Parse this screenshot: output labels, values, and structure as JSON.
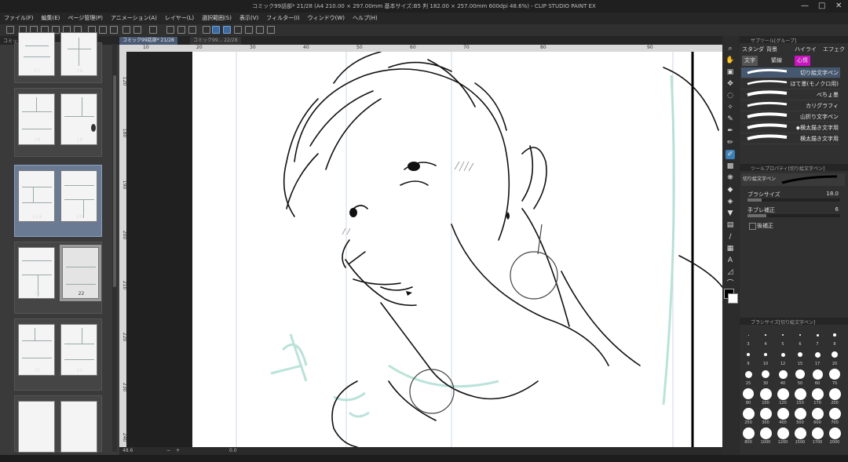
{
  "window": {
    "title": "コミック99話部* 21/28 (A4 210.00 × 297.00mm 基本サイズ:B5 判 182.00 × 257.00mm 600dpi 48.6%) - CLIP STUDIO PAINT EX",
    "controls": [
      "—",
      "□",
      "✕"
    ]
  },
  "menu": [
    "ファイル(F)",
    "編集(E)",
    "ページ管理(P)",
    "アニメーション(A)",
    "レイヤー(L)",
    "選択範囲(S)",
    "表示(V)",
    "フィルター(I)",
    "ウィンドウ(W)",
    "ヘルプ(H)"
  ],
  "page_manager": {
    "tab": "コミック99話部",
    "spreads": [
      {
        "left": "17",
        "right": "16",
        "selected": false
      },
      {
        "left": "19",
        "right": "18",
        "selected": false
      },
      {
        "left": "21★",
        "right": "20",
        "selected": true
      },
      {
        "left": "23",
        "right": "22",
        "selected": false
      },
      {
        "left": "25",
        "right": "24",
        "selected": false
      },
      {
        "left": "",
        "right": "",
        "selected": false
      }
    ]
  },
  "doc_tabs": [
    {
      "label": "コミック99話部* 21/28",
      "active": true
    },
    {
      "label": "コミック99... 22/28",
      "active": false
    }
  ],
  "ruler": {
    "h_ticks": [
      "10",
      "20",
      "30",
      "40",
      "50",
      "60",
      "70",
      "80",
      "90"
    ],
    "v_ticks": [
      "120",
      "180",
      "190",
      "200",
      "210",
      "220",
      "230",
      "240"
    ]
  },
  "status": {
    "zoom": "48.6",
    "angle": "0.0"
  },
  "subtool": {
    "header": "サブツール[グループ]",
    "groups_row1": [
      "スタンダ",
      "背景",
      "ハイライ",
      "エフェク"
    ],
    "groups_row2": [
      "文字",
      "緊線",
      "心情"
    ],
    "brushes": [
      {
        "label": "切り絵文字ペン",
        "selected": true
      },
      {
        "label": "ほて墨(モノクロ用)",
        "selected": false
      },
      {
        "label": "べちょ墨",
        "selected": false
      },
      {
        "label": "カリグラフィ",
        "selected": false
      },
      {
        "label": "山折り文字ペン",
        "selected": false
      },
      {
        "label": "◆横太描き文字用",
        "selected": false
      },
      {
        "label": "横太描き文字用",
        "selected": false
      }
    ]
  },
  "tool_property": {
    "header": "ツールプロパティ[切り絵文字ペン]",
    "brush_name": "切り絵文字ペン",
    "brush_size_label": "ブラシサイズ",
    "brush_size_value": "18.0",
    "stabilization_label": "手ブレ補正",
    "stabilization_value": "6",
    "post_correction_label": "後補正",
    "brush_size_fill": 0.15,
    "stabilization_fill": 0.2
  },
  "brush_size_panel": {
    "header": "ブラシサイズ[切り絵文字ペン]",
    "sizes": [
      "3",
      "4",
      "5",
      "6",
      "7",
      "8",
      "9",
      "10",
      "12",
      "15",
      "17",
      "20",
      "25",
      "30",
      "40",
      "50",
      "60",
      "70",
      "80",
      "100",
      "120",
      "150",
      "170",
      "200",
      "250",
      "300",
      "400",
      "500",
      "600",
      "700",
      "800",
      "1000",
      "1200",
      "1500",
      "1700",
      "2000"
    ]
  },
  "colors": {
    "main": "#000000",
    "sub": "#ffffff",
    "selection_blue": "#3a7fb5",
    "sketch_line": "#a9dccf"
  }
}
